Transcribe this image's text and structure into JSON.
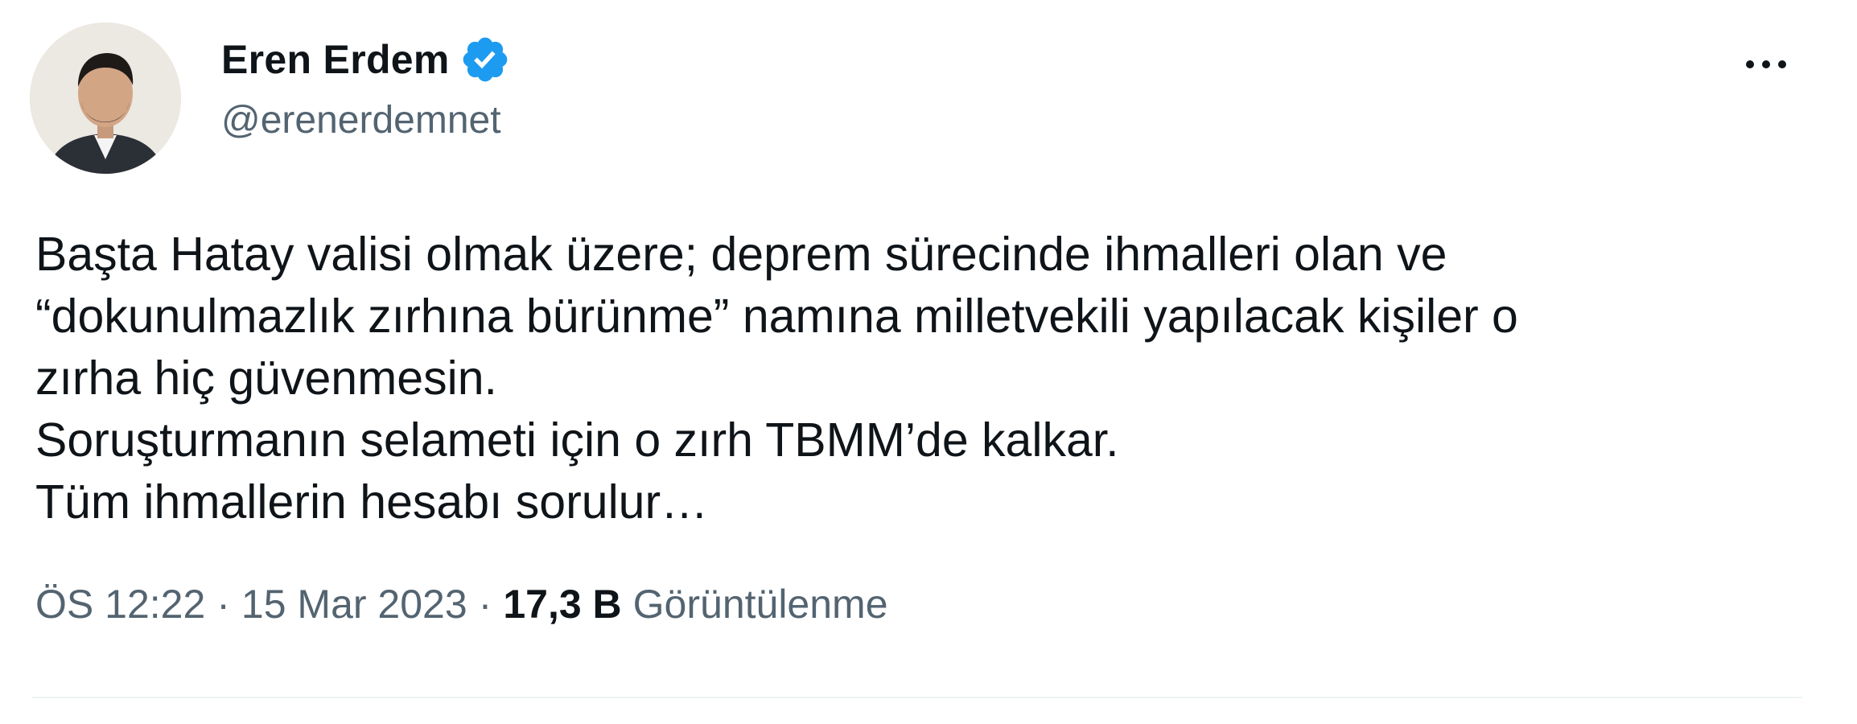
{
  "author": {
    "display_name": "Eren Erdem",
    "handle": "@erenerdemnet",
    "verified_icon": "verified-badge-icon",
    "verified_color": "#1d9bf0"
  },
  "more_icon": "more-horizontal-icon",
  "tweet": {
    "lines": [
      "Başta Hatay valisi olmak üzere; deprem sürecinde ihmalleri olan ve",
      "“dokunulmazlık zırhına bürünme” namına milletvekili yapılacak kişiler o",
      "zırha hiç güvenmesin.",
      "Soruşturmanın selameti için o zırh TBMM’de kalkar.",
      "Tüm ihmallerin hesabı sorulur…"
    ]
  },
  "meta": {
    "time": "ÖS 12:22",
    "separator": "·",
    "date": "15 Mar 2023",
    "views_count": "17,3 B",
    "views_label": "Görüntülenme"
  },
  "colors": {
    "text": "#0f1419",
    "secondary": "#536471",
    "divider": "#eff3f4"
  }
}
